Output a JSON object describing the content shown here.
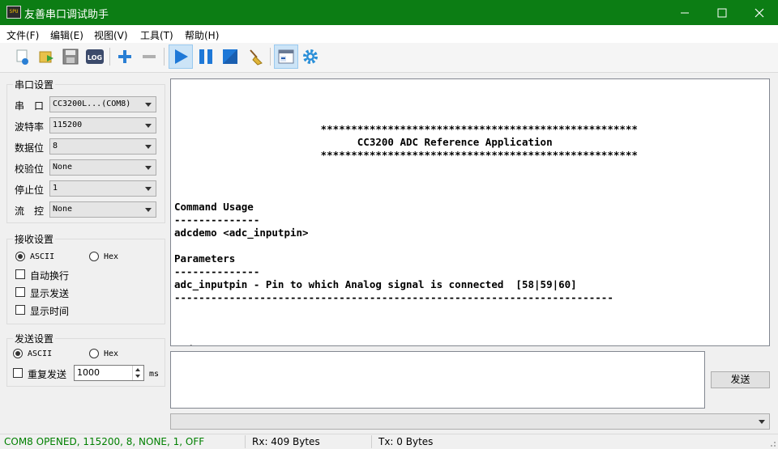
{
  "window": {
    "title": "友善串口调试助手",
    "icon_text": "SPU"
  },
  "menu": [
    "文件(F)",
    "编辑(E)",
    "视图(V)",
    "工具(T)",
    "帮助(H)"
  ],
  "toolbar": {
    "log_label": "LOG"
  },
  "serial_settings": {
    "title": "串口设置",
    "fields": [
      {
        "label": "串　口",
        "value": "CC3200L...(COM8)"
      },
      {
        "label": "波特率",
        "value": "115200"
      },
      {
        "label": "数据位",
        "value": "8"
      },
      {
        "label": "校验位",
        "value": "None"
      },
      {
        "label": "停止位",
        "value": "1"
      },
      {
        "label": "流　控",
        "value": "None"
      }
    ]
  },
  "receive_settings": {
    "title": "接收设置",
    "ascii": "ASCII",
    "hex": "Hex",
    "mode_selected": "ASCII",
    "auto_newline": "自动换行",
    "show_send": "显示发送",
    "show_time": "显示时间"
  },
  "send_settings": {
    "title": "发送设置",
    "ascii": "ASCII",
    "hex": "Hex",
    "mode_selected": "ASCII",
    "repeat_send": "重复发送",
    "interval": "1000",
    "unit": "ms"
  },
  "terminal_text": "                        ****************************************************\n                              CC3200 ADC Reference Application\n                        ****************************************************\n\n\n\nCommand Usage\n--------------\nadcdemo <adc_inputpin>\n\nParameters\n--------------\nadc_inputpin - Pin to which Analog signal is connected  [58|59|60]\n------------------------------------------------------------------------\n\n\n\ncmd#",
  "send_button": "发送",
  "status": {
    "connection": "COM8 OPENED, 115200, 8, NONE, 1, OFF",
    "rx": "Rx: 409 Bytes",
    "tx": "Tx: 0 Bytes"
  },
  "colors": {
    "title_bar": "#0c7d14",
    "status_ok": "#008000",
    "accent_blue": "#1e78d7"
  }
}
